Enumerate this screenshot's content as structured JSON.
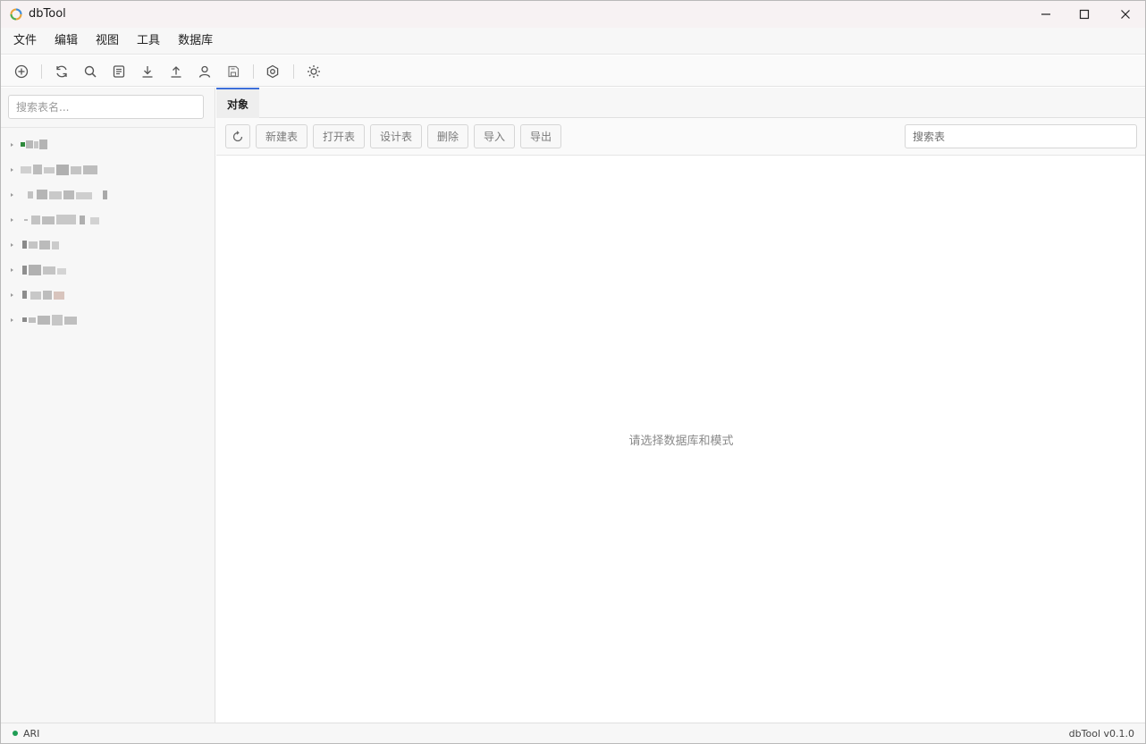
{
  "window": {
    "title": "dbTool",
    "controls": [
      "minimize-icon",
      "maximize-icon",
      "close-icon"
    ]
  },
  "menu": {
    "items": [
      "文件",
      "编辑",
      "视图",
      "工具",
      "数据库"
    ]
  },
  "toolbar": {
    "icons": [
      "add-connection-icon",
      "refresh-icon",
      "search-icon",
      "document-icon",
      "download-icon",
      "upload-icon",
      "user-icon",
      "save-icon",
      "settings-icon",
      "theme-sun-icon"
    ]
  },
  "sidebar": {
    "search_placeholder": "搜索表名..."
  },
  "tabs": [
    {
      "label": "对象",
      "active": true
    }
  ],
  "actions": {
    "refresh_icon": "refresh-icon",
    "buttons": [
      "新建表",
      "打开表",
      "设计表",
      "删除",
      "导入",
      "导出"
    ],
    "search_placeholder": "搜索表"
  },
  "main": {
    "empty_message": "请选择数据库和模式"
  },
  "status": {
    "connection_text": "ARI",
    "connection_color": "#1f9d55",
    "version": "dbTool v0.1.0"
  },
  "colors": {
    "accent": "#3d6fd9",
    "titlebar": "#f7f2f3"
  }
}
